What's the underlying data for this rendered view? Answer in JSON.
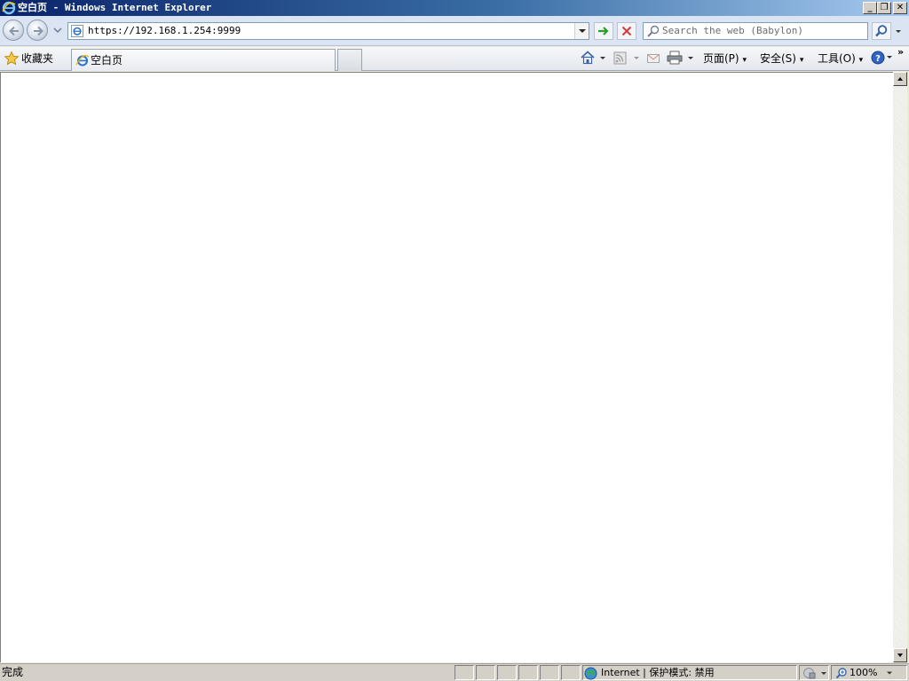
{
  "window": {
    "title": "空白页 - Windows Internet Explorer",
    "minimize_symbol": "_",
    "restore_symbol": "❐",
    "close_symbol": "✕"
  },
  "navbar": {
    "address": "https://192.168.1.254:9999",
    "search_placeholder": "Search the web (Babylon)"
  },
  "favorites": {
    "label": "收藏夹"
  },
  "tabs": [
    {
      "label": "空白页"
    }
  ],
  "commands": {
    "page_label": "页面(P)",
    "safety_label": "安全(S)",
    "tools_label": "工具(O)",
    "more_symbol": "»"
  },
  "status": {
    "text": "完成",
    "zone": "Internet | 保护模式: 禁用",
    "zoom": "100%"
  },
  "colors": {
    "titlebar_start": "#0a246a",
    "titlebar_end": "#a6caf0",
    "go_arrow": "#2e9d2e",
    "stop_x": "#d23b3b"
  }
}
